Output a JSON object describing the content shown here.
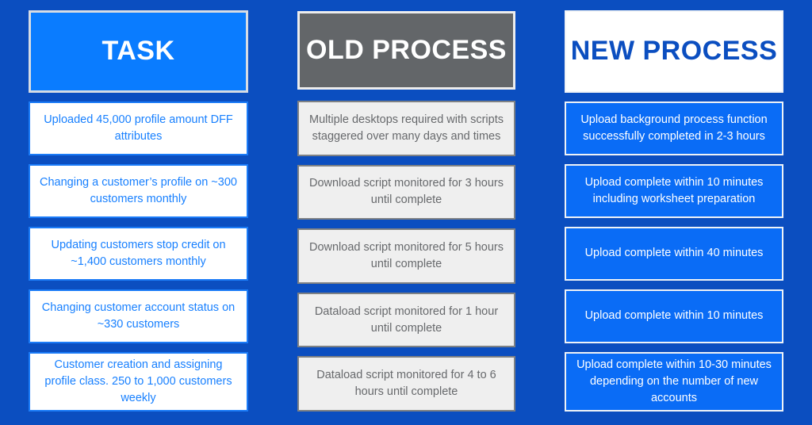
{
  "theme": {
    "background": "#0B4EC0",
    "task_accent": "#0A7CFF",
    "old_accent": "#636669",
    "new_accent": "#0A6CF6",
    "card_light": "#EFEFEF",
    "white": "#FFFFFF"
  },
  "columns": [
    {
      "id": "task",
      "header": "TASK",
      "cards": [
        "Uploaded 45,000 profile amount DFF attributes",
        "Changing a customer’s profile on ~300 customers monthly",
        "Updating customers stop credit on ~1,400 customers monthly",
        "Changing customer account status on ~330 customers",
        "Customer creation and assigning profile class. 250 to 1,000 customers weekly"
      ]
    },
    {
      "id": "old",
      "header": "OLD PROCESS",
      "cards": [
        "Multiple desktops required with scripts staggered over many days and times",
        "Download script monitored for 3 hours until complete",
        "Download script monitored for 5 hours until complete",
        "Dataload script monitored for 1 hour until complete",
        "Dataload script monitored for 4 to 6 hours until complete"
      ]
    },
    {
      "id": "new",
      "header": "NEW PROCESS",
      "cards": [
        "Upload background process function successfully completed in 2-3 hours",
        "Upload complete within 10 minutes including worksheet preparation",
        "Upload complete within 40 minutes",
        "Upload complete within 10 minutes",
        "Upload complete within 10-30 minutes depending on the number of new accounts"
      ]
    }
  ]
}
